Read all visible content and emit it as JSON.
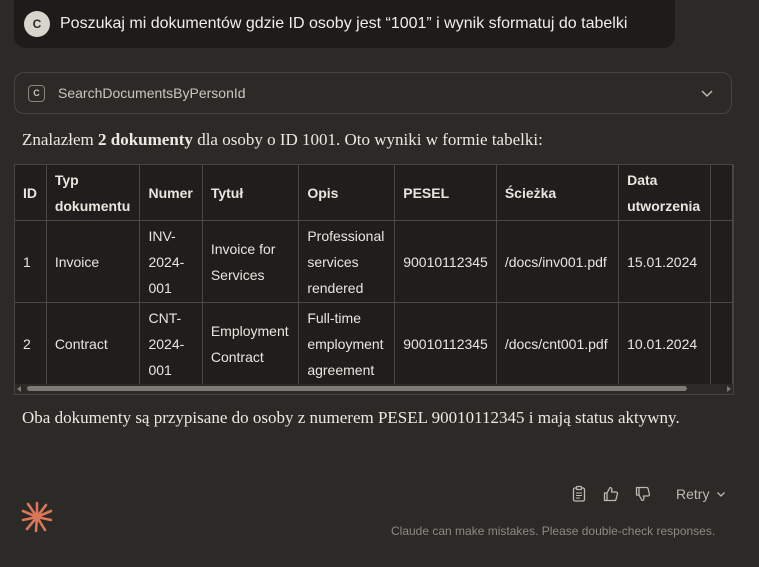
{
  "user_message": {
    "avatar_letter": "C",
    "text": "Poszukaj mi dokumentów gdzie ID osoby jest “1001” i wynik sformatuj do tabelki"
  },
  "tool_call": {
    "icon_letter": "C",
    "name": "SearchDocumentsByPersonId"
  },
  "response": {
    "intro_prefix": "Znalazłem ",
    "intro_bold": "2 dokumenty",
    "intro_suffix": " dla osoby o ID 1001. Oto wyniki w formie tabelki:",
    "outro": "Oba dokumenty są przypisane do osoby z numerem PESEL 90010112345 i mają status aktywny."
  },
  "table": {
    "headers": [
      "ID",
      "Typ dokumentu",
      "Numer",
      "Tytuł",
      "Opis",
      "PESEL",
      "Ścieżka",
      "Data utworzenia",
      ""
    ],
    "rows": [
      [
        "1",
        "Invoice",
        "INV-2024-001",
        "Invoice for Services",
        "Professional services rendered",
        "90010112345",
        "/docs/inv001.pdf",
        "15.01.2024",
        ""
      ],
      [
        "2",
        "Contract",
        "CNT-2024-001",
        "Employment Contract",
        "Full-time employment agreement",
        "90010112345",
        "/docs/cnt001.pdf",
        "10.01.2024",
        ""
      ]
    ]
  },
  "actions": {
    "icons": [
      "copy-icon",
      "thumbs-up-icon",
      "thumbs-down-icon"
    ],
    "retry_label": "Retry"
  },
  "disclaimer": "Claude can make mistakes. Please double-check responses.",
  "colors": {
    "background": "#2b2a27",
    "user_bubble": "#1d1c1a",
    "accent": "#d97757"
  }
}
